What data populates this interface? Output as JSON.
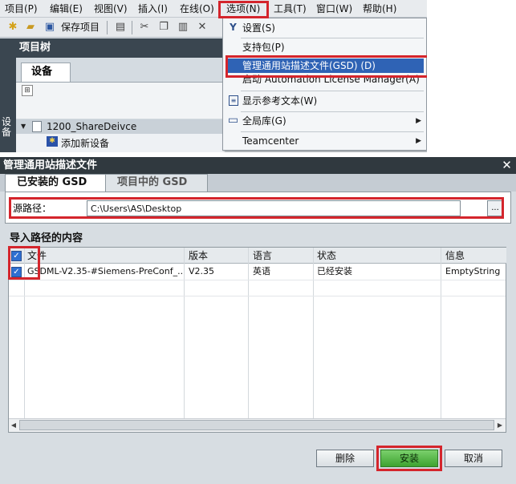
{
  "menubar": {
    "items": [
      "项目(P)",
      "编辑(E)",
      "视图(V)",
      "插入(I)",
      "在线(O)",
      "选项(N)",
      "工具(T)",
      "窗口(W)",
      "帮助(H)"
    ]
  },
  "toolbar": {
    "save_label": "保存项目"
  },
  "project_tree": {
    "title": "项目树",
    "tab_label": "设备",
    "side_label": "设备",
    "items": [
      {
        "label": "1200_ShareDeivce"
      },
      {
        "label": "添加新设备"
      }
    ]
  },
  "options_menu": {
    "items": [
      {
        "label": "设置(S)",
        "icon": "wrench-icon"
      },
      {
        "label": "支持包(P)",
        "icon": ""
      },
      {
        "label": "管理通用站描述文件(GSD) (D)",
        "icon": "",
        "selected": true
      },
      {
        "label": "启动 Automation License Manager(A)",
        "icon": ""
      },
      {
        "label": "显示参考文本(W)",
        "icon": "reference-text-icon"
      },
      {
        "label": "全局库(G)",
        "icon": "book-icon",
        "submenu": true
      },
      {
        "label": "Teamcenter",
        "icon": "",
        "submenu": true
      }
    ]
  },
  "dialog": {
    "title": "管理通用站描述文件",
    "close": "✕",
    "tabs": [
      "已安装的 GSD",
      "项目中的 GSD"
    ],
    "source_label": "源路径：",
    "source_path": "C:\\Users\\AS\\Desktop",
    "browse_label": "...",
    "content_title": "导入路径的内容",
    "columns": [
      "文件",
      "版本",
      "语言",
      "状态",
      "信息"
    ],
    "rows": [
      {
        "file": "GSDML-V2.35-#Siemens-PreConf_...",
        "version": "V2.35",
        "language": "英语",
        "status": "已经安装",
        "info": "EmptyString",
        "checked": true
      }
    ],
    "buttons": {
      "delete": "删除",
      "install": "安装",
      "cancel": "取消"
    }
  },
  "colors": {
    "highlight": "#d4252c",
    "menu_selected": "#2f63b5",
    "title_bar": "#30393f",
    "install_button": "#4fb540"
  }
}
